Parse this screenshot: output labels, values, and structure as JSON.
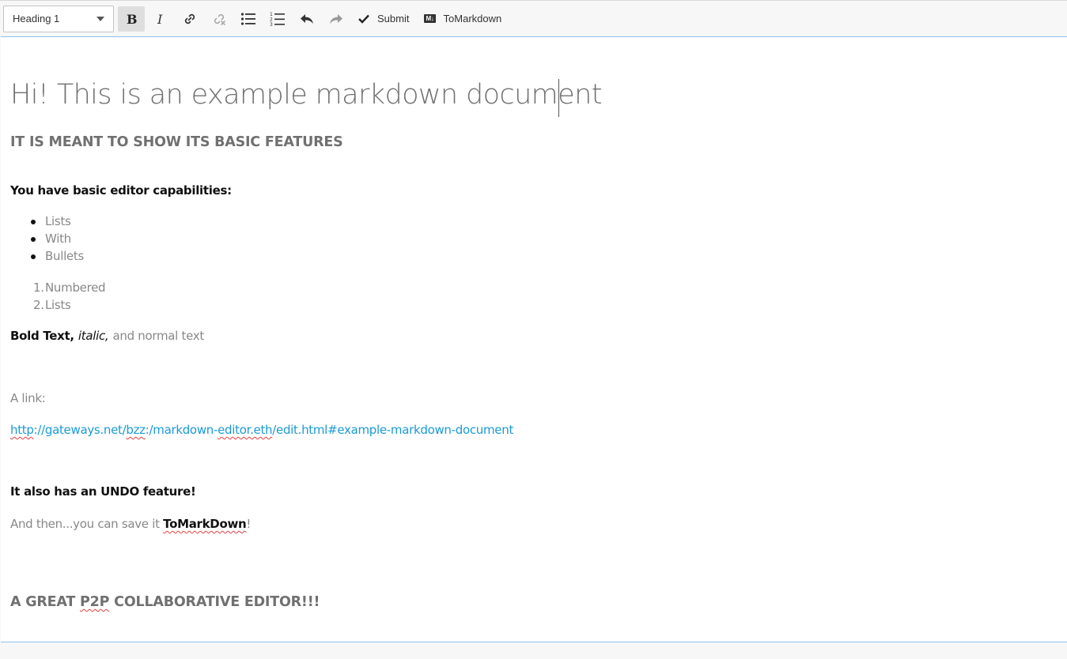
{
  "toolbar": {
    "heading_select": "Heading 1",
    "submit_label": "Submit",
    "markdown_badge": "M↓",
    "tomarkdown_label": "ToMarkdown"
  },
  "document": {
    "title": "Hi! This is an example markdown document",
    "subtitle": "IT IS MEANT TO SHOW ITS BASIC FEATURES",
    "capabilities_heading": "You have basic editor capabilities:",
    "bullets": [
      "Lists",
      "With",
      "Bullets"
    ],
    "numbered": [
      "Numbered",
      "Lists"
    ],
    "numbered_prefixes": [
      "1.",
      "2."
    ],
    "format_bold": "Bold Text,",
    "format_italic": "italic,",
    "format_normal": "and normal text",
    "link_label": "A link:",
    "link_parts": {
      "p1": "http",
      "p2": "://gateways.net/",
      "p3": "bzz",
      "p4": ":/markdown-",
      "p5": "editor.eth",
      "p6": "/edit.html#example-markdown-document"
    },
    "undo_heading": "It also has an UNDO feature!",
    "save_prefix": "And then...you can save it ",
    "save_bold": "ToMarkDown",
    "save_suffix": "!",
    "closing_a": "A GREAT ",
    "closing_p2p": "P2P",
    "closing_b": " COLLABORATIVE EDITOR!!!"
  },
  "colors": {
    "accent_border": "#8ec0f0",
    "link": "#1a9ad6",
    "heading_gray": "#707070"
  }
}
